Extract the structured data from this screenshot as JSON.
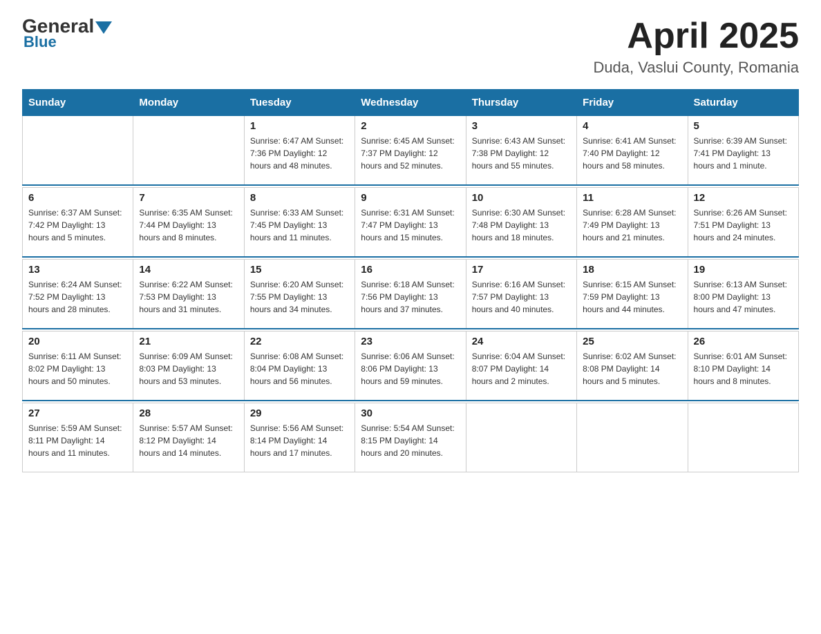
{
  "header": {
    "logo_general": "General",
    "logo_blue": "Blue",
    "title": "April 2025",
    "subtitle": "Duda, Vaslui County, Romania"
  },
  "weekdays": [
    "Sunday",
    "Monday",
    "Tuesday",
    "Wednesday",
    "Thursday",
    "Friday",
    "Saturday"
  ],
  "weeks": [
    [
      {
        "day": "",
        "info": ""
      },
      {
        "day": "",
        "info": ""
      },
      {
        "day": "1",
        "info": "Sunrise: 6:47 AM\nSunset: 7:36 PM\nDaylight: 12 hours\nand 48 minutes."
      },
      {
        "day": "2",
        "info": "Sunrise: 6:45 AM\nSunset: 7:37 PM\nDaylight: 12 hours\nand 52 minutes."
      },
      {
        "day": "3",
        "info": "Sunrise: 6:43 AM\nSunset: 7:38 PM\nDaylight: 12 hours\nand 55 minutes."
      },
      {
        "day": "4",
        "info": "Sunrise: 6:41 AM\nSunset: 7:40 PM\nDaylight: 12 hours\nand 58 minutes."
      },
      {
        "day": "5",
        "info": "Sunrise: 6:39 AM\nSunset: 7:41 PM\nDaylight: 13 hours\nand 1 minute."
      }
    ],
    [
      {
        "day": "6",
        "info": "Sunrise: 6:37 AM\nSunset: 7:42 PM\nDaylight: 13 hours\nand 5 minutes."
      },
      {
        "day": "7",
        "info": "Sunrise: 6:35 AM\nSunset: 7:44 PM\nDaylight: 13 hours\nand 8 minutes."
      },
      {
        "day": "8",
        "info": "Sunrise: 6:33 AM\nSunset: 7:45 PM\nDaylight: 13 hours\nand 11 minutes."
      },
      {
        "day": "9",
        "info": "Sunrise: 6:31 AM\nSunset: 7:47 PM\nDaylight: 13 hours\nand 15 minutes."
      },
      {
        "day": "10",
        "info": "Sunrise: 6:30 AM\nSunset: 7:48 PM\nDaylight: 13 hours\nand 18 minutes."
      },
      {
        "day": "11",
        "info": "Sunrise: 6:28 AM\nSunset: 7:49 PM\nDaylight: 13 hours\nand 21 minutes."
      },
      {
        "day": "12",
        "info": "Sunrise: 6:26 AM\nSunset: 7:51 PM\nDaylight: 13 hours\nand 24 minutes."
      }
    ],
    [
      {
        "day": "13",
        "info": "Sunrise: 6:24 AM\nSunset: 7:52 PM\nDaylight: 13 hours\nand 28 minutes."
      },
      {
        "day": "14",
        "info": "Sunrise: 6:22 AM\nSunset: 7:53 PM\nDaylight: 13 hours\nand 31 minutes."
      },
      {
        "day": "15",
        "info": "Sunrise: 6:20 AM\nSunset: 7:55 PM\nDaylight: 13 hours\nand 34 minutes."
      },
      {
        "day": "16",
        "info": "Sunrise: 6:18 AM\nSunset: 7:56 PM\nDaylight: 13 hours\nand 37 minutes."
      },
      {
        "day": "17",
        "info": "Sunrise: 6:16 AM\nSunset: 7:57 PM\nDaylight: 13 hours\nand 40 minutes."
      },
      {
        "day": "18",
        "info": "Sunrise: 6:15 AM\nSunset: 7:59 PM\nDaylight: 13 hours\nand 44 minutes."
      },
      {
        "day": "19",
        "info": "Sunrise: 6:13 AM\nSunset: 8:00 PM\nDaylight: 13 hours\nand 47 minutes."
      }
    ],
    [
      {
        "day": "20",
        "info": "Sunrise: 6:11 AM\nSunset: 8:02 PM\nDaylight: 13 hours\nand 50 minutes."
      },
      {
        "day": "21",
        "info": "Sunrise: 6:09 AM\nSunset: 8:03 PM\nDaylight: 13 hours\nand 53 minutes."
      },
      {
        "day": "22",
        "info": "Sunrise: 6:08 AM\nSunset: 8:04 PM\nDaylight: 13 hours\nand 56 minutes."
      },
      {
        "day": "23",
        "info": "Sunrise: 6:06 AM\nSunset: 8:06 PM\nDaylight: 13 hours\nand 59 minutes."
      },
      {
        "day": "24",
        "info": "Sunrise: 6:04 AM\nSunset: 8:07 PM\nDaylight: 14 hours\nand 2 minutes."
      },
      {
        "day": "25",
        "info": "Sunrise: 6:02 AM\nSunset: 8:08 PM\nDaylight: 14 hours\nand 5 minutes."
      },
      {
        "day": "26",
        "info": "Sunrise: 6:01 AM\nSunset: 8:10 PM\nDaylight: 14 hours\nand 8 minutes."
      }
    ],
    [
      {
        "day": "27",
        "info": "Sunrise: 5:59 AM\nSunset: 8:11 PM\nDaylight: 14 hours\nand 11 minutes."
      },
      {
        "day": "28",
        "info": "Sunrise: 5:57 AM\nSunset: 8:12 PM\nDaylight: 14 hours\nand 14 minutes."
      },
      {
        "day": "29",
        "info": "Sunrise: 5:56 AM\nSunset: 8:14 PM\nDaylight: 14 hours\nand 17 minutes."
      },
      {
        "day": "30",
        "info": "Sunrise: 5:54 AM\nSunset: 8:15 PM\nDaylight: 14 hours\nand 20 minutes."
      },
      {
        "day": "",
        "info": ""
      },
      {
        "day": "",
        "info": ""
      },
      {
        "day": "",
        "info": ""
      }
    ]
  ]
}
